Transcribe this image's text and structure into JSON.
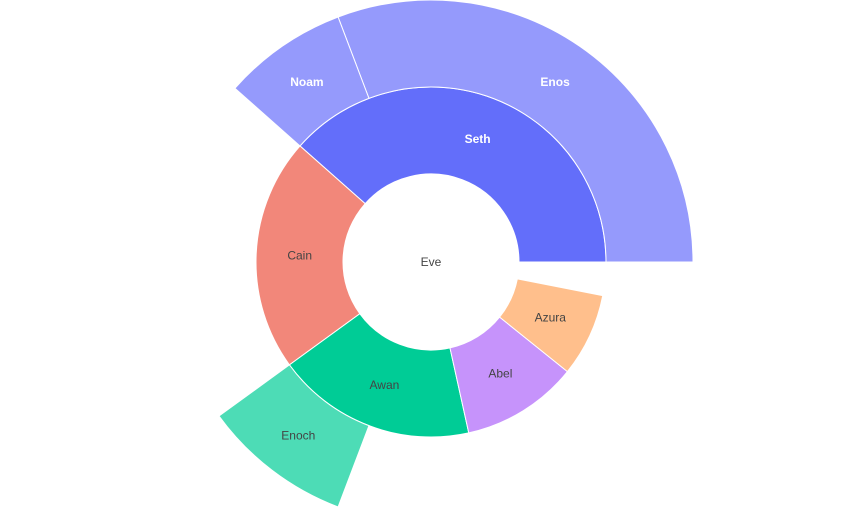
{
  "chart_data": {
    "type": "sunburst",
    "root": "Eve",
    "nodes": [
      {
        "label": "Eve",
        "parent": "",
        "value": 65,
        "color": "#ffffff",
        "text_color": "#444444"
      },
      {
        "label": "Seth",
        "parent": "Eve",
        "value": 25,
        "color": "#636efa",
        "text_color": "#ffffff"
      },
      {
        "label": "Cain",
        "parent": "Eve",
        "value": 14,
        "color": "#f2877a",
        "text_color": "#444444"
      },
      {
        "label": "Awan",
        "parent": "Eve",
        "value": 12,
        "color": "#00cc96",
        "text_color": "#444444"
      },
      {
        "label": "Abel",
        "parent": "Eve",
        "value": 7,
        "color": "#c693fb",
        "text_color": "#444444"
      },
      {
        "label": "Azura",
        "parent": "Eve",
        "value": 5,
        "color": "#ffbf8c",
        "text_color": "#444444"
      },
      {
        "label": "Enos",
        "parent": "Seth",
        "value": 20,
        "color": "#959afc",
        "text_color": "#ffffff"
      },
      {
        "label": "Noam",
        "parent": "Seth",
        "value": 5,
        "color": "#959afc",
        "text_color": "#ffffff"
      },
      {
        "label": "Enoch",
        "parent": "Awan",
        "value": 6,
        "color": "#4ddcb6",
        "text_color": "#444444"
      }
    ]
  }
}
